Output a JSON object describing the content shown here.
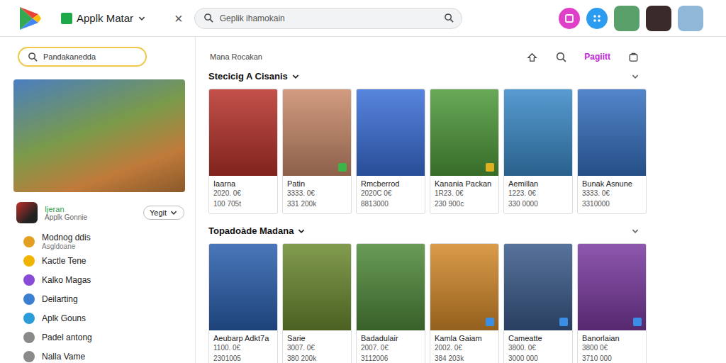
{
  "top_bar": {
    "app_name": "Applk Matar",
    "close": "×",
    "search_placeholder": "Geplik ihamokain",
    "avatars": [
      {
        "color": "#5aa06a"
      },
      {
        "color": "#3a2a2a"
      },
      {
        "color": "#8fb8d8"
      }
    ]
  },
  "sidebar": {
    "search_placeholder": "Pandakanedda",
    "featured_app": {
      "name": "Ijeran",
      "developer": "Applk Gonnie",
      "button": "Yegit"
    },
    "items": [
      {
        "label": "Modnog ddis",
        "sublabel": "Asgldoane",
        "color": "#e3a020"
      },
      {
        "label": "Kactle Tene",
        "color": "#f0b400"
      },
      {
        "label": "Kalko Magas",
        "color": "#8a4ad8"
      },
      {
        "label": "Deilarting",
        "color": "#3a7fd0"
      },
      {
        "label": "Aplk Gouns",
        "color": "#2d9cdb"
      },
      {
        "label": "Padel antong",
        "color": "#8a8a8a"
      },
      {
        "label": "Nalla Vame",
        "color": "#8a8a8a"
      }
    ]
  },
  "main": {
    "title": "Mana Rocakan",
    "action": "Pagiitt",
    "sections": [
      {
        "title": "Stecicig A Cisanis",
        "cards": [
          {
            "name": "Iaarna",
            "price": "2020. 0€",
            "count": "100 705t",
            "color": "#b8322a"
          },
          {
            "name": "Patin",
            "price": "3333. 0€",
            "count": "331 200k",
            "color": "#c98a6a",
            "badge": "#3cb44a"
          },
          {
            "name": "Rmcberrod",
            "price": "2020C 0€",
            "count": "8813000",
            "color": "#3a6fd8"
          },
          {
            "name": "Kanania Packan",
            "price": "1R23. 0€",
            "count": "230 900c",
            "color": "#4e9a3a",
            "badge": "#e0b020"
          },
          {
            "name": "Aemillan",
            "price": "1223. 0€",
            "count": "330 0000",
            "color": "#3a8ac8"
          },
          {
            "name": "Bunak Asnune",
            "price": "3333. 0€",
            "count": "3310000",
            "color": "#3570c0"
          }
        ]
      },
      {
        "title": "Topadoàde Madana",
        "cards": [
          {
            "name": "Aeubarp Adkt7a",
            "price": "1100. 0€",
            "count": "2301005",
            "color": "#2a5fae"
          },
          {
            "name": "Sarie",
            "price": "3007. 0€",
            "count": "380 200k",
            "color": "#6b8a30"
          },
          {
            "name": "Badadulair",
            "price": "2007. 0€",
            "count": "3112006",
            "color": "#4f8a3a"
          },
          {
            "name": "Kamla Gaiam",
            "price": "2002. 0€",
            "count": "384 203k",
            "color": "#d48a2a",
            "badge": "#3a8ee6"
          },
          {
            "name": "Cameatte",
            "price": "3800. 0€",
            "count": "3000 000",
            "color": "#3a5a8a",
            "badge": "#3a8ee6"
          },
          {
            "name": "Banorlaian",
            "price": "3800 0€",
            "count": "3710 000",
            "color": "#7a3aa0",
            "badge": "#3a8ee6"
          }
        ]
      }
    ]
  }
}
